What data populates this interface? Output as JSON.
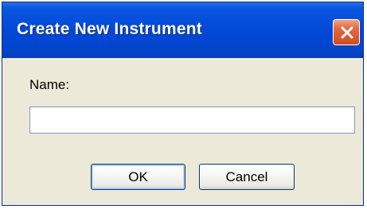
{
  "dialog": {
    "title": "Create New Instrument",
    "close_icon": "close-icon",
    "name_label": "Name:",
    "name_value": "",
    "ok_label": "OK",
    "cancel_label": "Cancel"
  },
  "colors": {
    "titlebar": "#0248d8",
    "background": "#ece9d8",
    "close_button": "#d24c22"
  }
}
